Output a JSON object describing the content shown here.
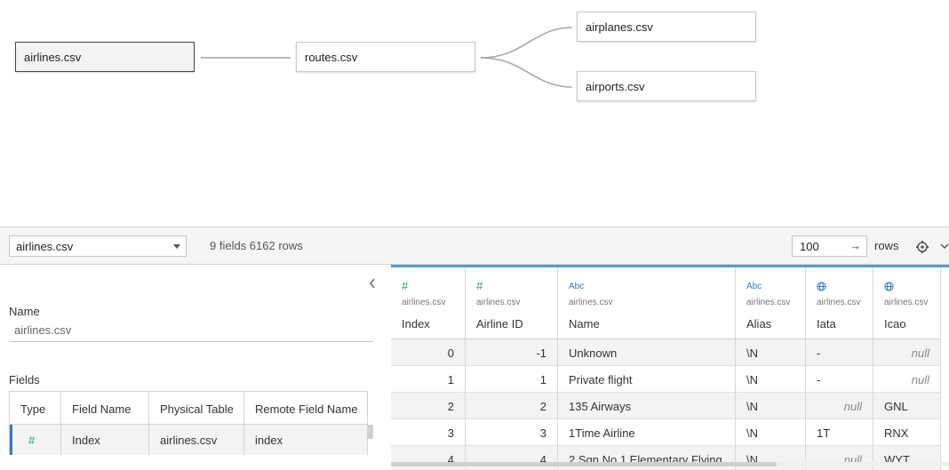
{
  "canvas": {
    "tables": {
      "airlines": "airlines.csv",
      "routes": "routes.csv",
      "airplanes": "airplanes.csv",
      "airports": "airports.csv"
    }
  },
  "toolbar": {
    "table_select": "airlines.csv",
    "summary": "9 fields 6162 rows",
    "rows_value": "100",
    "rows_arrow": "→",
    "rows_label": "rows"
  },
  "metadata": {
    "name_label": "Name",
    "name_value": "airlines.csv",
    "fields_label": "Fields",
    "columns": [
      "Type",
      "Field Name",
      "Physical Table",
      "Remote Field Name"
    ],
    "rows": [
      {
        "type_icon": "#",
        "field_name": "Index",
        "physical_table": "airlines.csv",
        "remote_field_name": "index"
      }
    ]
  },
  "grid": {
    "columns": [
      {
        "type": "number",
        "type_icon": "#",
        "source": "airlines.csv",
        "name": "Index"
      },
      {
        "type": "number",
        "type_icon": "#",
        "source": "airlines.csv",
        "name": "Airline ID"
      },
      {
        "type": "string",
        "type_icon": "Abc",
        "source": "airlines.csv",
        "name": "Name"
      },
      {
        "type": "string",
        "type_icon": "Abc",
        "source": "airlines.csv",
        "name": "Alias"
      },
      {
        "type": "geo",
        "type_icon": "globe",
        "source": "airlines.csv",
        "name": "Iata"
      },
      {
        "type": "geo",
        "type_icon": "globe",
        "source": "airlines.csv",
        "name": "Icao"
      }
    ],
    "rows": [
      [
        "0",
        "-1",
        "Unknown",
        "\\N",
        "-",
        "null"
      ],
      [
        "1",
        "1",
        "Private flight",
        "\\N",
        "-",
        "null"
      ],
      [
        "2",
        "2",
        "135 Airways",
        "\\N",
        "null",
        "GNL"
      ],
      [
        "3",
        "3",
        "1Time Airline",
        "\\N",
        "1T",
        "RNX"
      ],
      [
        "4",
        "4",
        "2 Sqn No 1 Elementary Flying ...",
        "\\N",
        "null",
        "WYT"
      ]
    ]
  },
  "colors": {
    "accent_blue": "#2e7cc1",
    "number_green": "#2aa05c",
    "header_rule": "#5b9bc8"
  }
}
